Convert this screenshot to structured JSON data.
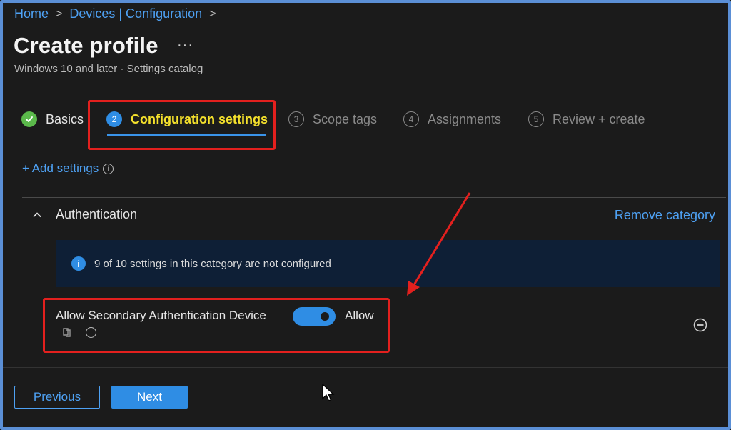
{
  "breadcrumb": {
    "home": "Home",
    "section": "Devices | Configuration",
    "separator": ">"
  },
  "header": {
    "title": "Create profile",
    "more_label": "···",
    "subtitle": "Windows 10 and later - Settings catalog"
  },
  "tabs": [
    {
      "step": "",
      "label": "Basics",
      "state": "done"
    },
    {
      "step": "2",
      "label": "Configuration settings",
      "state": "active"
    },
    {
      "step": "3",
      "label": "Scope tags",
      "state": "inactive"
    },
    {
      "step": "4",
      "label": "Assignments",
      "state": "inactive"
    },
    {
      "step": "5",
      "label": "Review + create",
      "state": "inactive"
    }
  ],
  "add_settings": {
    "label": "+ Add settings",
    "info_icon": "i"
  },
  "category": {
    "name": "Authentication",
    "remove_label": "Remove category",
    "info_banner": "9 of 10 settings in this category are not configured",
    "info_icon": "i"
  },
  "setting": {
    "name": "Allow Secondary Authentication Device",
    "toggle_on": true,
    "value_label": "Allow",
    "info_icon": "i"
  },
  "footer": {
    "previous_label": "Previous",
    "next_label": "Next"
  },
  "colors": {
    "accent": "#2f8de4",
    "link": "#4ea1f3",
    "highlight_text": "#f5e12c",
    "annotation": "#e3201e",
    "success": "#5bb94b"
  }
}
